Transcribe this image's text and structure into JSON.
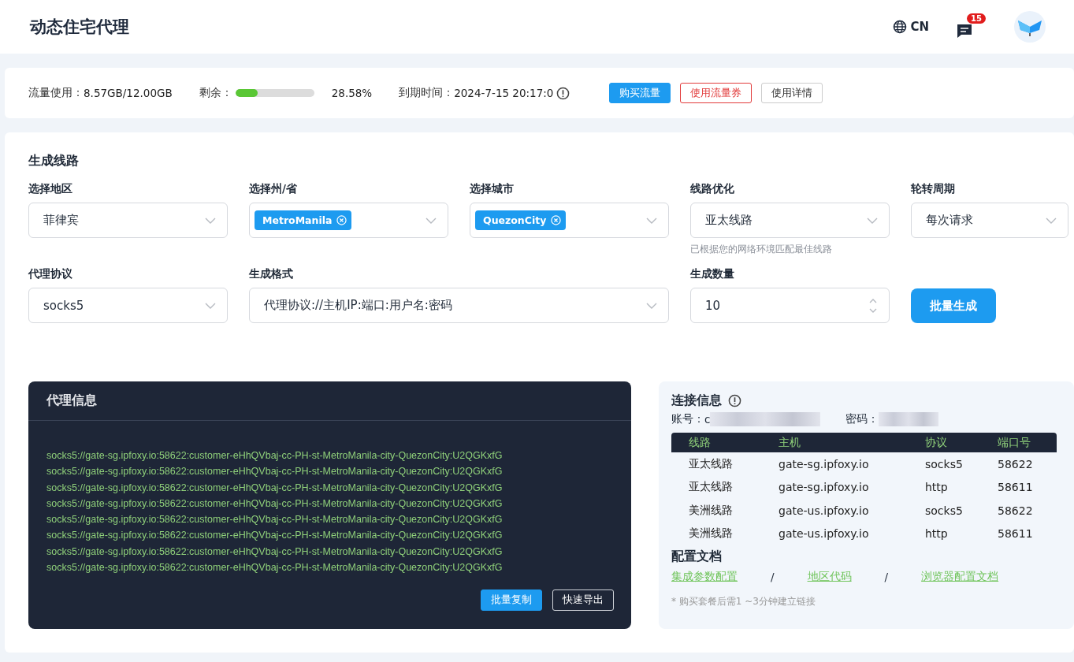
{
  "header": {
    "title": "动态住宅代理",
    "language": "CN",
    "notification_count": "15"
  },
  "usage": {
    "used_label": "流量使用：",
    "used_value": "8.57GB/12.00GB",
    "remaining_label": "剩余：",
    "level": 0.2858,
    "percent": "28.58%",
    "expiry_label": "到期时间：",
    "expiry_value": "2024-7-15 20:17:0",
    "buttons": [
      {
        "label": "购买流量",
        "kind": "primary"
      },
      {
        "label": "使用流量券",
        "kind": "danger"
      },
      {
        "label": "使用详情",
        "kind": "plain"
      }
    ]
  },
  "generator": {
    "title": "生成线路",
    "fields": [
      {
        "label": "选择地区",
        "kind": "select",
        "value": "菲律宾"
      },
      {
        "label": "选择州/省",
        "kind": "tags",
        "tags": [
          "MetroManila"
        ]
      },
      {
        "label": "选择城市",
        "kind": "tags",
        "tags": [
          "QuezonCity"
        ]
      },
      {
        "label": "线路优化",
        "kind": "select",
        "value": "亚太线路",
        "hint": "已根据您的网络环境匹配最佳线路"
      },
      {
        "label": "轮转周期",
        "kind": "select",
        "value": "每次请求"
      },
      {
        "label": "代理协议",
        "kind": "select",
        "value": "socks5"
      },
      {
        "label": "生成格式",
        "kind": "select",
        "value": "代理协议://主机IP:端口:用户名:密码",
        "wide": true
      },
      {
        "label": "生成数量",
        "kind": "number",
        "value": "10"
      }
    ],
    "generate_button": "批量生成"
  },
  "proxy_info": {
    "title": "代理信息",
    "lines": [
      "socks5://gate-sg.ipfoxy.io:58622:customer-eHhQVbaj-cc-PH-st-MetroManila-city-QuezonCity:U2QGKxfG",
      "socks5://gate-sg.ipfoxy.io:58622:customer-eHhQVbaj-cc-PH-st-MetroManila-city-QuezonCity:U2QGKxfG",
      "socks5://gate-sg.ipfoxy.io:58622:customer-eHhQVbaj-cc-PH-st-MetroManila-city-QuezonCity:U2QGKxfG",
      "socks5://gate-sg.ipfoxy.io:58622:customer-eHhQVbaj-cc-PH-st-MetroManila-city-QuezonCity:U2QGKxfG",
      "socks5://gate-sg.ipfoxy.io:58622:customer-eHhQVbaj-cc-PH-st-MetroManila-city-QuezonCity:U2QGKxfG",
      "socks5://gate-sg.ipfoxy.io:58622:customer-eHhQVbaj-cc-PH-st-MetroManila-city-QuezonCity:U2QGKxfG",
      "socks5://gate-sg.ipfoxy.io:58622:customer-eHhQVbaj-cc-PH-st-MetroManila-city-QuezonCity:U2QGKxfG",
      "socks5://gate-sg.ipfoxy.io:58622:customer-eHhQVbaj-cc-PH-st-MetroManila-city-QuezonCity:U2QGKxfG"
    ],
    "buttons": [
      {
        "label": "批量复制",
        "kind": "primary"
      },
      {
        "label": "快速导出",
        "kind": "outline"
      }
    ]
  },
  "connection": {
    "title": "连接信息",
    "account_label": "账号：",
    "account_value": "c",
    "password_label": "密码：",
    "table": {
      "columns": [
        "线路",
        "主机",
        "协议",
        "端口号"
      ],
      "rows": [
        [
          "亚太线路",
          "gate-sg.ipfoxy.io",
          "socks5",
          "58622"
        ],
        [
          "亚太线路",
          "gate-sg.ipfoxy.io",
          "http",
          "58611"
        ],
        [
          "美洲线路",
          "gate-us.ipfoxy.io",
          "socks5",
          "58622"
        ],
        [
          "美洲线路",
          "gate-us.ipfoxy.io",
          "http",
          "58611"
        ]
      ]
    },
    "docs_title": "配置文档",
    "doc_links": [
      "集成参数配置",
      "地区代码",
      "浏览器配置文档"
    ],
    "separator": "/",
    "note": "* 购买套餐后需1 ~3分钟建立链接"
  }
}
